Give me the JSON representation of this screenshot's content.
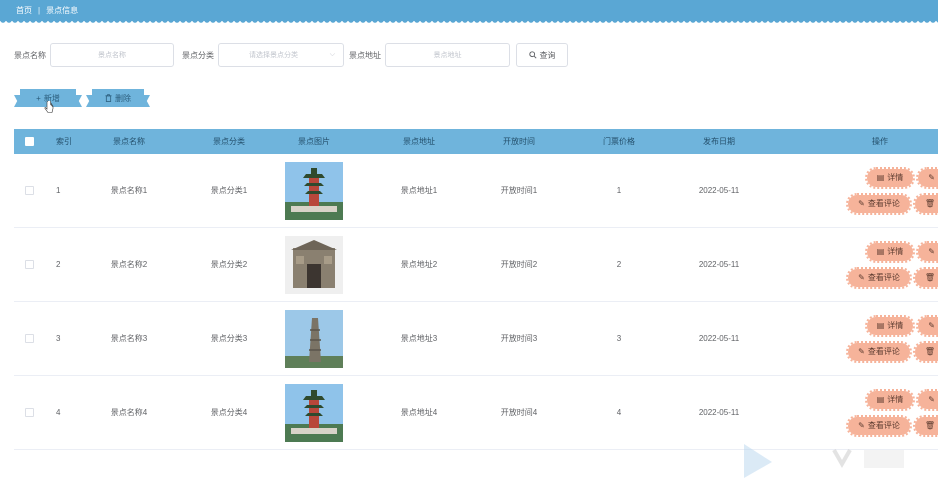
{
  "breadcrumb": {
    "home": "首页",
    "current": "景点信息"
  },
  "search": {
    "name_label": "景点名称",
    "name_placeholder": "景点名称",
    "category_label": "景点分类",
    "category_placeholder": "请选择景点分类",
    "address_label": "景点地址",
    "address_placeholder": "景点地址",
    "query_label": "查询"
  },
  "actions": {
    "add_label": "新增",
    "delete_label": "删除"
  },
  "table": {
    "headers": {
      "index": "索引",
      "name": "景点名称",
      "category": "景点分类",
      "image": "景点图片",
      "address": "景点地址",
      "open_time": "开放时间",
      "price": "门票价格",
      "date": "发布日期",
      "ops": "操作"
    },
    "rows": [
      {
        "index": "1",
        "name": "景点名称1",
        "category": "景点分类1",
        "address": "景点地址1",
        "open_time": "开放时间1",
        "price": "1",
        "date": "2022-05-11",
        "image_icon": "pagoda-photo"
      },
      {
        "index": "2",
        "name": "景点名称2",
        "category": "景点分类2",
        "address": "景点地址2",
        "open_time": "开放时间2",
        "price": "2",
        "date": "2022-05-11",
        "image_icon": "stone-gate-photo"
      },
      {
        "index": "3",
        "name": "景点名称3",
        "category": "景点分类3",
        "address": "景点地址3",
        "open_time": "开放时间3",
        "price": "3",
        "date": "2022-05-11",
        "image_icon": "stone-tower-photo"
      },
      {
        "index": "4",
        "name": "景点名称4",
        "category": "景点分类4",
        "address": "景点地址4",
        "open_time": "开放时间4",
        "price": "4",
        "date": "2022-05-11",
        "image_icon": "pagoda-photo"
      }
    ],
    "op_labels": {
      "detail": "详情",
      "edit": "修改",
      "review": "查看评论",
      "delete": "删除"
    }
  },
  "colors": {
    "header": "#5aa7d4",
    "table_header": "#6fb4dc",
    "op_button": "#f6b39a"
  }
}
